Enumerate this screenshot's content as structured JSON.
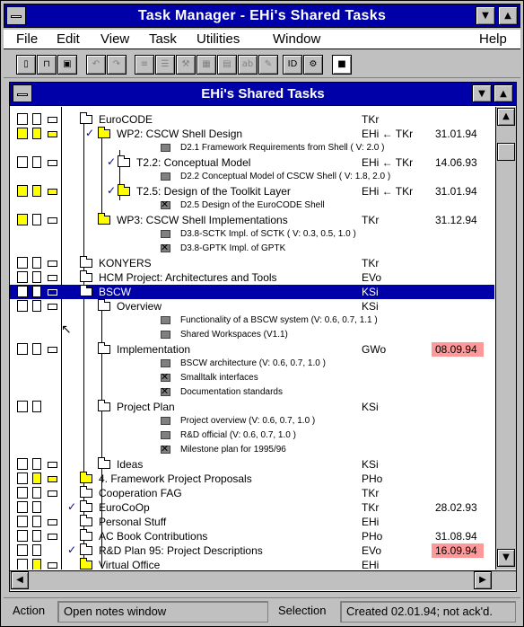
{
  "window": {
    "title": "Task Manager - EHi's Shared Tasks"
  },
  "menu": [
    "File",
    "Edit",
    "View",
    "Task",
    "Utilities",
    "Window",
    "Help"
  ],
  "document": {
    "title": "EHi's Shared Tasks"
  },
  "rows": [
    {
      "name": "EuroCODE",
      "owner": "TKr",
      "date": ""
    },
    {
      "name": "WP2: CSCW Shell Design",
      "owner": "EHi ← TKr",
      "date": "31.01.94"
    },
    {
      "name": "D2.1 Framework Requirements from Shell ( V: 2.0 )",
      "owner": "",
      "date": ""
    },
    {
      "name": "T2.2: Conceptual Model",
      "owner": "EHi ← TKr",
      "date": "14.06.93"
    },
    {
      "name": "D2.2 Conceptual Model of CSCW Shell ( V: 1.8, 2.0 )",
      "owner": "",
      "date": ""
    },
    {
      "name": "T2.5: Design of the Toolkit Layer",
      "owner": "EHi ← TKr",
      "date": "31.01.94"
    },
    {
      "name": "D2.5 Design of the EuroCODE Shell",
      "owner": "",
      "date": ""
    },
    {
      "name": "WP3: CSCW Shell Implementations",
      "owner": "TKr",
      "date": "31.12.94"
    },
    {
      "name": "D3.8-SCTK Impl. of SCTK ( V: 0.3, 0.5, 1.0 )",
      "owner": "",
      "date": ""
    },
    {
      "name": "D3.8-GPTK Impl. of GPTK",
      "owner": "",
      "date": ""
    },
    {
      "name": "KONYERS",
      "owner": "TKr",
      "date": ""
    },
    {
      "name": "HCM Project: Architectures and Tools",
      "owner": "EVo",
      "date": ""
    },
    {
      "name": "BSCW",
      "owner": "KSi",
      "date": ""
    },
    {
      "name": "Overview",
      "owner": "KSi",
      "date": ""
    },
    {
      "name": "Functionality of a BSCW system  (V: 0.6, 0.7, 1.1 )",
      "owner": "",
      "date": ""
    },
    {
      "name": "Shared Workspaces (V1.1)",
      "owner": "",
      "date": ""
    },
    {
      "name": "Implementation",
      "owner": "GWo",
      "date": "08.09.94"
    },
    {
      "name": "BSCW architecture  (V: 0.6, 0.7, 1.0 )",
      "owner": "",
      "date": ""
    },
    {
      "name": "Smalltalk interfaces",
      "owner": "",
      "date": ""
    },
    {
      "name": "Documentation standards",
      "owner": "",
      "date": ""
    },
    {
      "name": "Project Plan",
      "owner": "KSi",
      "date": ""
    },
    {
      "name": "Project overview  (V: 0.6, 0.7, 1.0 )",
      "owner": "",
      "date": ""
    },
    {
      "name": "R&D official  (V: 0.6, 0.7, 1.0 )",
      "owner": "",
      "date": ""
    },
    {
      "name": "Milestone plan for 1995/96",
      "owner": "",
      "date": ""
    },
    {
      "name": "Ideas",
      "owner": "KSi",
      "date": ""
    },
    {
      "name": "4. Framework Project Proposals",
      "owner": "PHo",
      "date": ""
    },
    {
      "name": "Cooperation FAG",
      "owner": "TKr",
      "date": ""
    },
    {
      "name": "EuroCoOp",
      "owner": "TKr",
      "date": "28.02.93"
    },
    {
      "name": "Personal Stuff",
      "owner": "EHi",
      "date": ""
    },
    {
      "name": "AC Book Contributions",
      "owner": "PHo",
      "date": "31.08.94"
    },
    {
      "name": "R&D Plan 95: Project Descriptions",
      "owner": "EVo",
      "date": "16.09.94"
    },
    {
      "name": "Virtual Office",
      "owner": "EHi",
      "date": ""
    }
  ],
  "status": {
    "action_label": "Action",
    "action_value": "Open notes window",
    "selection_label": "Selection",
    "selection_value": "Created 02.01.94; not ack'd."
  },
  "colors": {
    "titlebar": "#0000a8",
    "alert_date": "#ff9999",
    "folder_highlight": "#ffff00"
  }
}
